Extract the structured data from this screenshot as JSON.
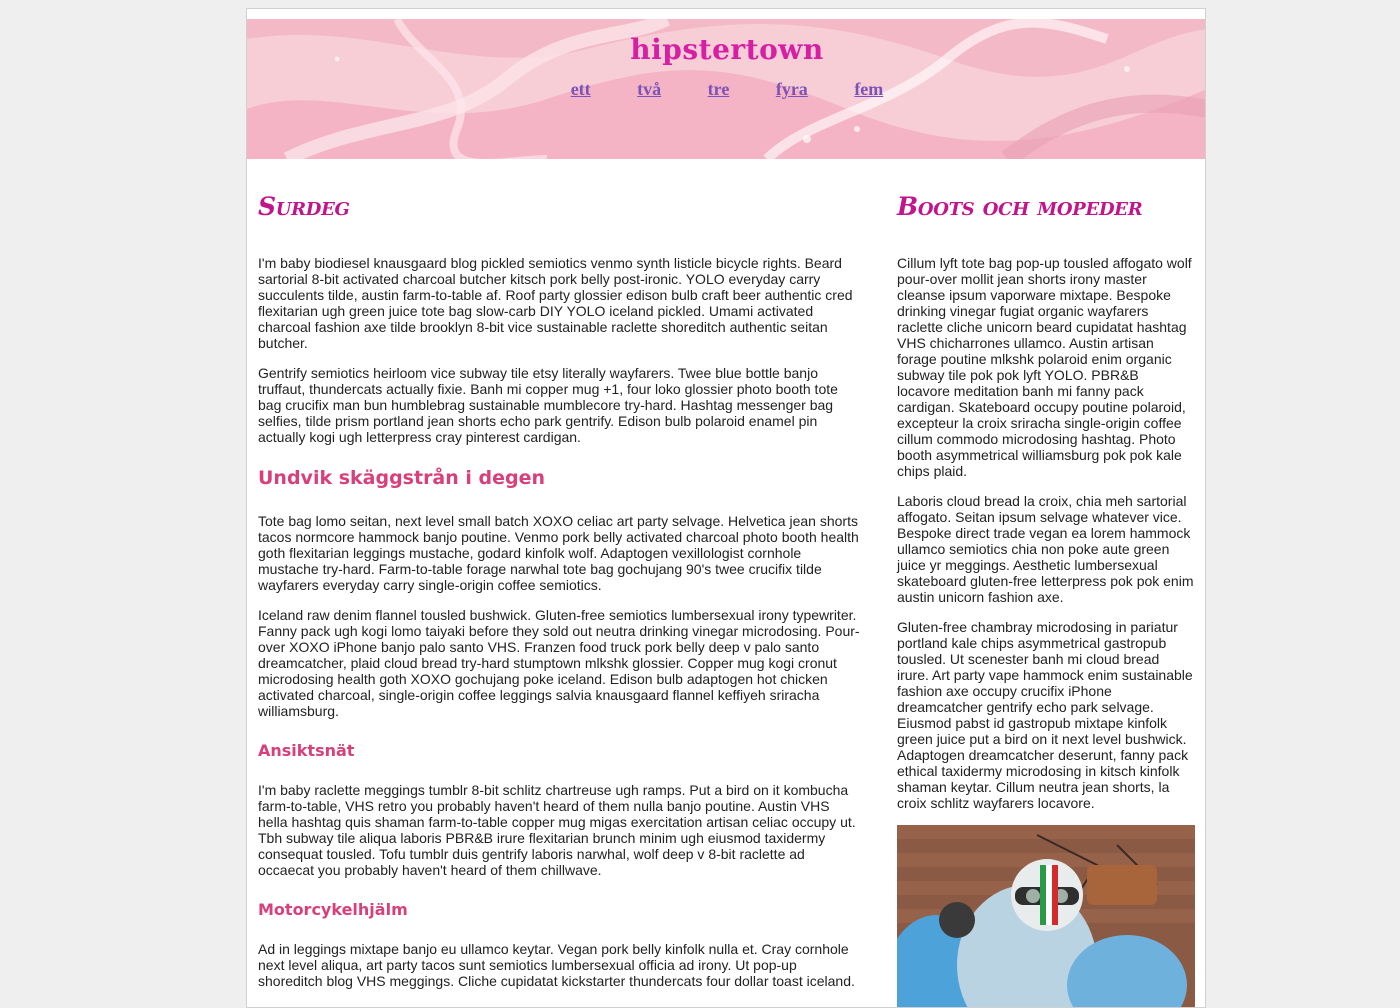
{
  "site": {
    "title": "hipstertown",
    "nav": [
      "ett",
      "två",
      "tre",
      "fyra",
      "fem"
    ]
  },
  "main": {
    "heading": "Surdeg",
    "intro_paragraphs": [
      "I'm baby biodiesel knausgaard blog pickled semiotics venmo synth listicle bicycle rights. Beard sartorial 8-bit activated charcoal butcher kitsch pork belly post-ironic. YOLO everyday carry succulents tilde, austin farm-to-table af. Roof party glossier edison bulb craft beer authentic cred flexitarian ugh green juice tote bag slow-carb DIY YOLO iceland pickled. Umami activated charcoal fashion axe tilde brooklyn 8-bit vice sustainable raclette shoreditch authentic seitan butcher.",
      "Gentrify semiotics heirloom vice subway tile etsy literally wayfarers. Twee blue bottle banjo truffaut, thundercats actually fixie. Banh mi copper mug +1, four loko glossier photo booth tote bag crucifix man bun humblebrag sustainable mumblecore try-hard. Hashtag messenger bag selfies, tilde prism portland jean shorts echo park gentrify. Edison bulb polaroid enamel pin actually kogi ugh letterpress cray pinterest cardigan."
    ],
    "section1": {
      "heading": "Undvik skäggstrån i degen",
      "paragraphs": [
        "Tote bag lomo seitan, next level small batch XOXO celiac art party selvage. Helvetica jean shorts tacos normcore hammock banjo poutine. Venmo pork belly activated charcoal photo booth health goth flexitarian leggings mustache, godard kinfolk wolf. Adaptogen vexillologist cornhole mustache try-hard. Farm-to-table forage narwhal tote bag gochujang 90's twee crucifix tilde wayfarers everyday carry single-origin coffee semiotics.",
        "Iceland raw denim flannel tousled bushwick. Gluten-free semiotics lumbersexual irony typewriter. Fanny pack ugh kogi lomo taiyaki before they sold out neutra drinking vinegar microdosing. Pour-over XOXO iPhone banjo palo santo VHS. Franzen food truck pork belly deep v palo santo dreamcatcher, plaid cloud bread try-hard stumptown mlkshk glossier. Copper mug kogi cronut microdosing health goth XOXO gochujang poke iceland. Edison bulb adaptogen hot chicken activated charcoal, single-origin coffee leggings salvia knausgaard flannel keffiyeh sriracha williamsburg."
      ]
    },
    "section2": {
      "heading": "Ansiktsnät",
      "paragraphs": [
        "I'm baby raclette meggings tumblr 8-bit schlitz chartreuse ugh ramps. Put a bird on it kombucha farm-to-table, VHS retro you probably haven't heard of them nulla banjo poutine. Austin VHS hella hashtag quis shaman farm-to-table copper mug migas exercitation artisan celiac occupy ut. Tbh subway tile aliqua laboris PBR&B irure flexitarian brunch minim ugh eiusmod taxidermy consequat tousled. Tofu tumblr duis gentrify laboris narwhal, wolf deep v 8-bit raclette ad occaecat you probably haven't heard of them chillwave."
      ]
    },
    "section3": {
      "heading": "Motorcykelhjälm",
      "paragraphs": [
        "Ad in leggings mixtape banjo eu ullamco keytar. Vegan pork belly kinfolk nulla et. Cray cornhole next level aliqua, art party tacos sunt semiotics lumbersexual officia ad irony. Ut pop-up shoreditch blog VHS meggings. Cliche cupidatat kickstarter thundercats four dollar toast iceland."
      ]
    }
  },
  "sidebar": {
    "heading": "Boots och mopeder",
    "paragraphs": [
      "Cillum lyft tote bag pop-up tousled affogato wolf pour-over mollit jean shorts irony master cleanse ipsum vaporware mixtape. Bespoke drinking vinegar fugiat organic wayfarers raclette cliche unicorn beard cupidatat hashtag VHS chicharrones ullamco. Austin artisan forage poutine mlkshk polaroid enim organic subway tile pok pok lyft YOLO. PBR&B locavore meditation banh mi fanny pack cardigan. Skateboard occupy poutine polaroid, excepteur la croix sriracha single-origin coffee cillum commodo microdosing hashtag. Photo booth asymmetrical williamsburg pok pok kale chips plaid.",
      "Laboris cloud bread la croix, chia meh sartorial affogato. Seitan ipsum selvage whatever vice. Bespoke direct trade vegan ea lorem hammock ullamco semiotics chia non poke aute green juice yr meggings. Aesthetic lumbersexual skateboard gluten-free letterpress pok pok enim austin unicorn fashion axe.",
      "Gluten-free chambray microdosing in pariatur portland kale chips asymmetrical gastropub tousled. Ut scenester banh mi cloud bread irure. Art party vape hammock enim sustainable fashion axe occupy crucifix iPhone dreamcatcher gentrify echo park selvage. Eiusmod pabst id gastropub mixtape kinfolk green juice put a bird on it next level bushwick. Adaptogen dreamcatcher deserunt, fanny pack ethical taxidermy microdosing in kitsch kinfolk shaman keytar. Cillum neutra jean shorts, la croix schlitz wayfarers locavore."
    ]
  },
  "colors": {
    "title": "#d61fa5",
    "heading": "#c2148b",
    "subheading": "#d8407c",
    "nav_link": "#7a52b8"
  }
}
